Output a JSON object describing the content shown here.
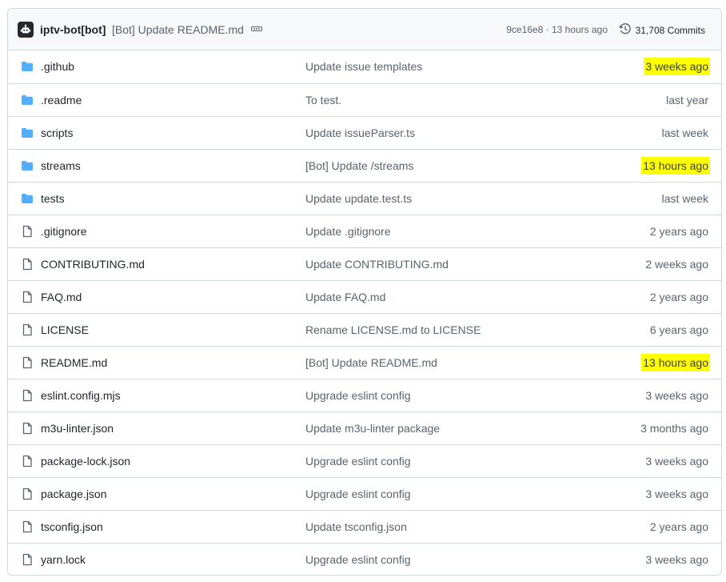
{
  "header": {
    "author": "iptv-bot[bot]",
    "message": "[Bot] Update README.md",
    "meta": "9ce16e8 · 13 hours ago",
    "commits_label": "31,708 Commits"
  },
  "colors": {
    "folder": "#54aeff",
    "file_icon": "#59636e",
    "highlight": "#ffff00"
  },
  "files": [
    {
      "name": ".github",
      "type": "folder",
      "icon": "folder-icon",
      "message": "Update issue templates",
      "time": "3 weeks ago",
      "highlighted": true
    },
    {
      "name": ".readme",
      "type": "folder",
      "icon": "folder-icon",
      "message": "To test.",
      "time": "last year",
      "highlighted": false
    },
    {
      "name": "scripts",
      "type": "folder",
      "icon": "folder-icon",
      "message": "Update issueParser.ts",
      "time": "last week",
      "highlighted": false
    },
    {
      "name": "streams",
      "type": "folder",
      "icon": "folder-icon",
      "message": "[Bot] Update /streams",
      "time": "13 hours ago",
      "highlighted": true
    },
    {
      "name": "tests",
      "type": "folder",
      "icon": "folder-icon",
      "message": "Update update.test.ts",
      "time": "last week",
      "highlighted": false
    },
    {
      "name": ".gitignore",
      "type": "file",
      "icon": "file-icon",
      "message": "Update .gitignore",
      "time": "2 years ago",
      "highlighted": false
    },
    {
      "name": "CONTRIBUTING.md",
      "type": "file",
      "icon": "file-icon",
      "message": "Update CONTRIBUTING.md",
      "time": "2 weeks ago",
      "highlighted": false
    },
    {
      "name": "FAQ.md",
      "type": "file",
      "icon": "file-icon",
      "message": "Update FAQ.md",
      "time": "2 years ago",
      "highlighted": false
    },
    {
      "name": "LICENSE",
      "type": "file",
      "icon": "file-icon",
      "message": "Rename LICENSE.md to LICENSE",
      "time": "6 years ago",
      "highlighted": false
    },
    {
      "name": "README.md",
      "type": "file",
      "icon": "file-icon",
      "message": "[Bot] Update README.md",
      "time": "13 hours ago",
      "highlighted": true
    },
    {
      "name": "eslint.config.mjs",
      "type": "file",
      "icon": "file-icon",
      "message": "Upgrade eslint config",
      "time": "3 weeks ago",
      "highlighted": false
    },
    {
      "name": "m3u-linter.json",
      "type": "file",
      "icon": "file-icon",
      "message": "Update m3u-linter package",
      "time": "3 months ago",
      "highlighted": false
    },
    {
      "name": "package-lock.json",
      "type": "file",
      "icon": "file-icon",
      "message": "Upgrade eslint config",
      "time": "3 weeks ago",
      "highlighted": false
    },
    {
      "name": "package.json",
      "type": "file",
      "icon": "file-icon",
      "message": "Upgrade eslint config",
      "time": "3 weeks ago",
      "highlighted": false
    },
    {
      "name": "tsconfig.json",
      "type": "file",
      "icon": "file-icon",
      "message": "Update tsconfig.json",
      "time": "2 years ago",
      "highlighted": false
    },
    {
      "name": "yarn.lock",
      "type": "file",
      "icon": "file-icon",
      "message": "Upgrade eslint config",
      "time": "3 weeks ago",
      "highlighted": false
    }
  ]
}
